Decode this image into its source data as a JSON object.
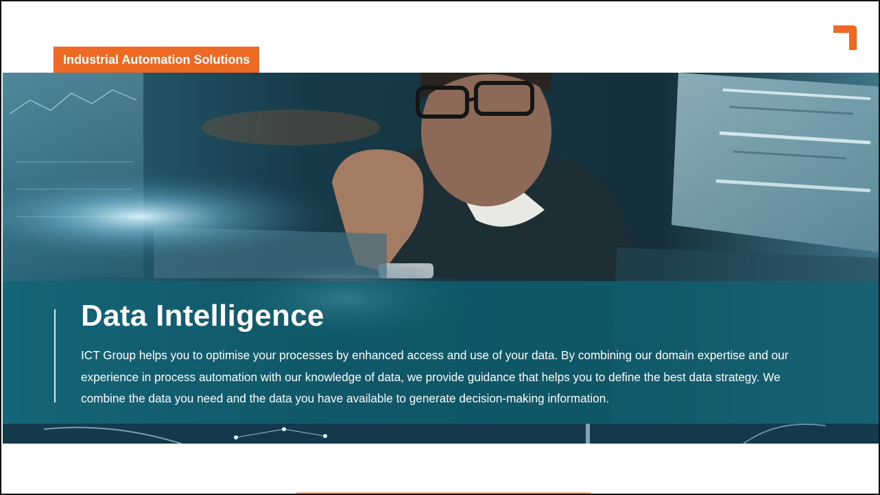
{
  "brand": {
    "accent_color": "#ee6a24",
    "logo_icon": "corner-bracket-icon"
  },
  "tag": {
    "label": "Industrial Automation Solutions"
  },
  "hero": {
    "image": "person-with-data-screens-photo",
    "overlay_color": "#0e6476",
    "title": "Data Intelligence",
    "body": "ICT Group helps you to optimise your processes by enhanced access and use of your data. By combining our domain expertise and our experience in process automation with our knowledge of data, we provide guidance that helps you to define the best data strategy. We combine the data you need and the data you have available to generate decision-making information."
  }
}
